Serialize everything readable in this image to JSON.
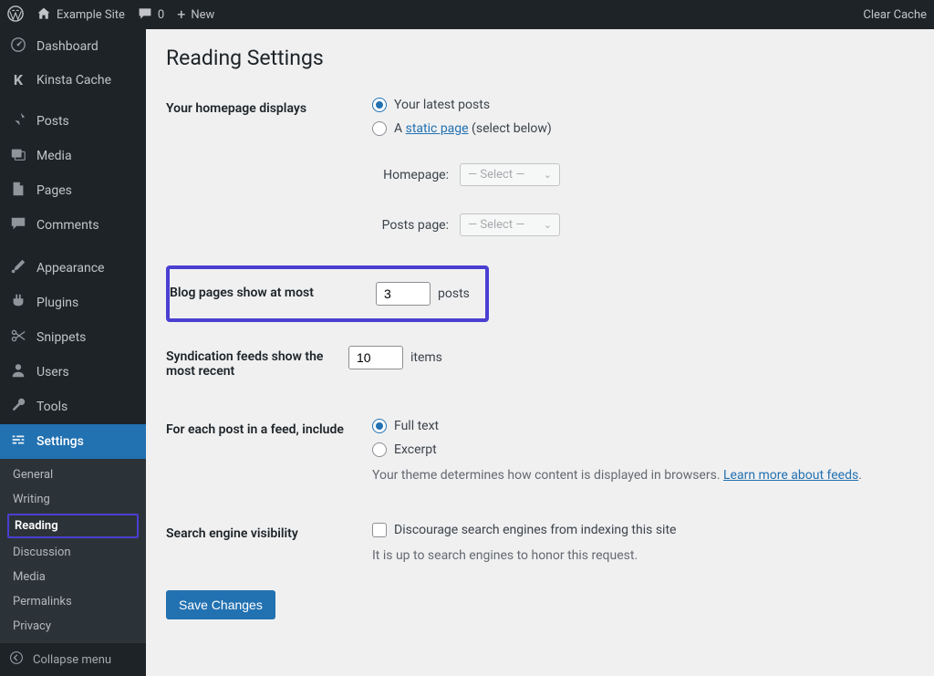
{
  "toolbar": {
    "site_name": "Example Site",
    "comment_count": "0",
    "new_label": "New",
    "clear_cache": "Clear Cache"
  },
  "sidebar": {
    "dashboard": "Dashboard",
    "kinsta": "Kinsta Cache",
    "posts": "Posts",
    "media": "Media",
    "pages": "Pages",
    "comments": "Comments",
    "appearance": "Appearance",
    "plugins": "Plugins",
    "snippets": "Snippets",
    "users": "Users",
    "tools": "Tools",
    "settings": "Settings",
    "collapse": "Collapse menu",
    "settings_submenu": {
      "general": "General",
      "writing": "Writing",
      "reading": "Reading",
      "discussion": "Discussion",
      "media": "Media",
      "permalinks": "Permalinks",
      "privacy": "Privacy"
    }
  },
  "page": {
    "title": "Reading Settings",
    "homepage_displays_label": "Your homepage displays",
    "latest_posts_label": "Your latest posts",
    "static_page_pre": "A ",
    "static_page_link": "static page",
    "static_page_post": " (select below)",
    "homepage_select_label": "Homepage:",
    "posts_page_select_label": "Posts page:",
    "select_placeholder": "— Select —",
    "blog_pages_label": "Blog pages show at most",
    "blog_pages_value": "3",
    "blog_pages_unit": "posts",
    "syndication_label": "Syndication feeds show the most recent",
    "syndication_value": "10",
    "syndication_unit": "items",
    "feed_include_label": "For each post in a feed, include",
    "full_text": "Full text",
    "excerpt": "Excerpt",
    "feed_desc_pre": "Your theme determines how content is displayed in browsers. ",
    "feed_desc_link": "Learn more about feeds",
    "feed_desc_post": ".",
    "sev_label": "Search engine visibility",
    "sev_checkbox_label": "Discourage search engines from indexing this site",
    "sev_desc": "It is up to search engines to honor this request.",
    "save_button": "Save Changes"
  }
}
